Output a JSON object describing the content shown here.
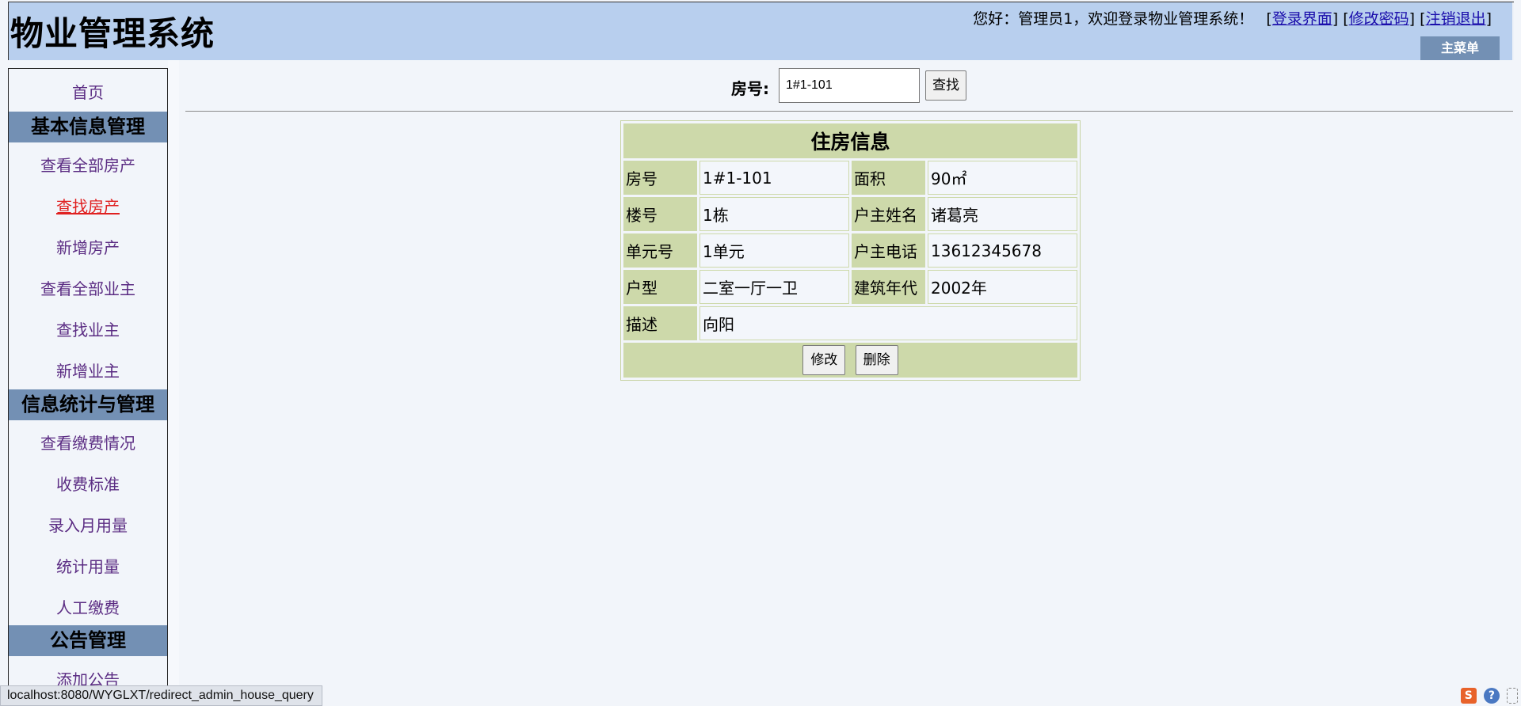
{
  "app": {
    "title": "物业管理系统",
    "greeting": "您好：管理员1，欢迎登录物业管理系统！",
    "links": {
      "login": "登录界面",
      "change_password": "修改密码",
      "logout": "注销退出"
    },
    "main_menu": "主菜单"
  },
  "sidebar": {
    "home": "首页",
    "sections": [
      {
        "title": "基本信息管理",
        "items": [
          "查看全部房产",
          "查找房产",
          "新增房产",
          "查看全部业主",
          "查找业主",
          "新增业主"
        ]
      },
      {
        "title": "信息统计与管理",
        "items": [
          "查看缴费情况",
          "收费标准",
          "录入月用量",
          "统计用量",
          "人工缴费"
        ]
      },
      {
        "title": "公告管理",
        "items": [
          "添加公告"
        ]
      }
    ],
    "active_item": "查找房产"
  },
  "search": {
    "label": "房号:",
    "value": "1#1-101",
    "button": "查找"
  },
  "house_info": {
    "title": "住房信息",
    "rows": [
      [
        "房号",
        "1#1-101",
        "面积",
        "90㎡"
      ],
      [
        "楼号",
        "1栋",
        "户主姓名",
        "诸葛亮"
      ],
      [
        "单元号",
        "1单元",
        "户主电话",
        "13612345678"
      ],
      [
        "户型",
        "二室一厅一卫",
        "建筑年代",
        "2002年"
      ]
    ],
    "description_label": "描述",
    "description": "向阳",
    "edit_button": "修改",
    "delete_button": "删除"
  },
  "status_bar": {
    "url": "localhost:8080/WYGLXT/redirect_admin_house_query"
  },
  "colors": {
    "header_bg": "#b8cfee",
    "section_header_bg": "#7390b4",
    "table_key_bg": "#cdd9aa",
    "link_color": "#5b2c83",
    "active_link_color": "#e02020"
  }
}
